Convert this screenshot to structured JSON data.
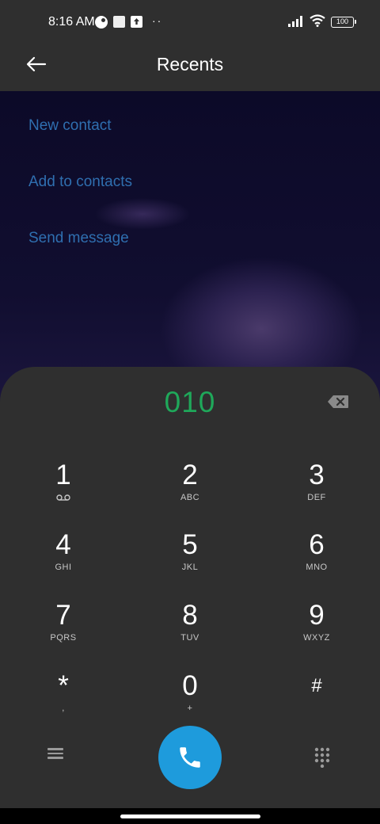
{
  "status_bar": {
    "time": "8:16 AM",
    "dots": "··",
    "battery": "100",
    "icons": [
      "cycle-icon",
      "square-notification-icon",
      "upload-icon",
      "signal-icon",
      "wifi-icon",
      "battery-icon"
    ]
  },
  "header": {
    "title": "Recents",
    "back_icon": "arrow-left-icon"
  },
  "actions": [
    {
      "label": "New contact"
    },
    {
      "label": "Add to contacts"
    },
    {
      "label": "Send message"
    }
  ],
  "dialer": {
    "number": "010",
    "keys": [
      {
        "digit": "1",
        "letters": ""
      },
      {
        "digit": "2",
        "letters": "ABC"
      },
      {
        "digit": "3",
        "letters": "DEF"
      },
      {
        "digit": "4",
        "letters": "GHI"
      },
      {
        "digit": "5",
        "letters": "JKL"
      },
      {
        "digit": "6",
        "letters": "MNO"
      },
      {
        "digit": "7",
        "letters": "PQRS"
      },
      {
        "digit": "8",
        "letters": "TUV"
      },
      {
        "digit": "9",
        "letters": "WXYZ"
      },
      {
        "digit": "*",
        "letters": ","
      },
      {
        "digit": "0",
        "letters": "+"
      },
      {
        "digit": "#",
        "letters": ""
      }
    ]
  },
  "colors": {
    "accent_call": "#1e9bdc",
    "number_green": "#1fa85a",
    "link_blue": "#2f6fb0",
    "panel": "#2f2f2f"
  }
}
